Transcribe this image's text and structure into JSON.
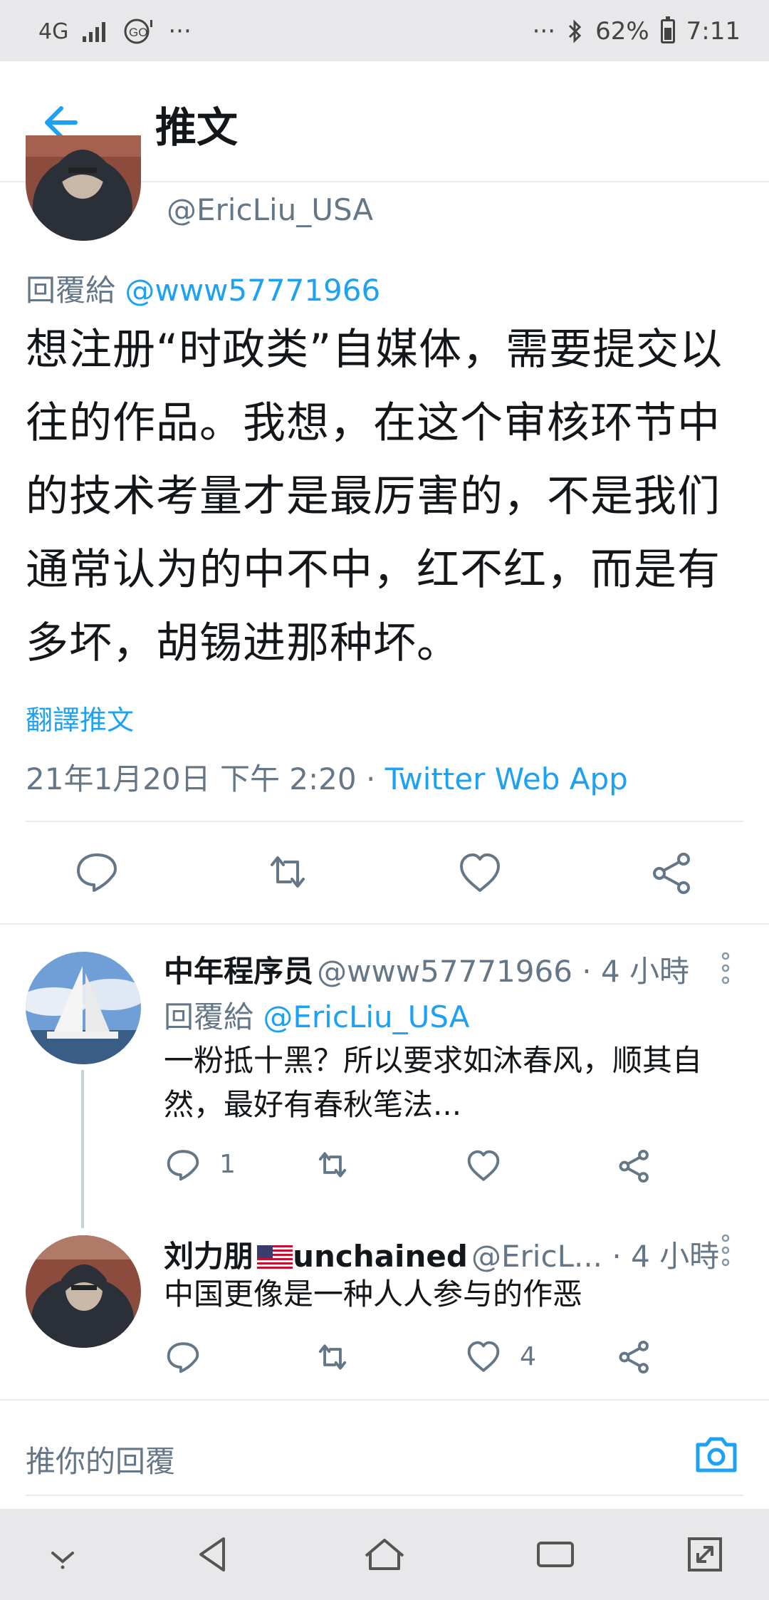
{
  "status_bar": {
    "network": "4G",
    "left_extra": "···",
    "right_extra": "···",
    "battery": "62%",
    "time": "7:11"
  },
  "header": {
    "title": "推文"
  },
  "main_tweet": {
    "handle": "@EricLiu_USA",
    "reply_to_label": "回覆給",
    "reply_to_user": "@www57771966",
    "text": "想注册“时政类”自媒体，需要提交以往的作品。我想，在这个审核环节中的技术考量才是最厉害的，不是我们通常认为的中不中，红不红，而是有多坏，胡锡进那种坏。",
    "translate": "翻譯推文",
    "date": "21年1月20日 下午 2:20 · ",
    "source": "Twitter Web App"
  },
  "replies": [
    {
      "name": "中年程序员",
      "handle": "@www57771966 · 4 小時",
      "reply_to_label": "回覆給",
      "reply_to_user": "@EricLiu_USA",
      "text": "一粉抵十黑？所以要求如沐春风，顺其自然，最好有春秋笔法...",
      "reply_count": "1",
      "like_count": ""
    },
    {
      "name": "刘力朋",
      "name_suffix": "unchained",
      "handle": "@EricL... · 4 小時",
      "text": "中国更像是一种人人参与的作恶",
      "reply_count": "",
      "like_count": "4"
    }
  ],
  "compose": {
    "placeholder": "推你的回覆"
  },
  "colors": {
    "accent": "#1da1f2",
    "secondary_text": "#657786",
    "divider": "#e6ecf0"
  }
}
